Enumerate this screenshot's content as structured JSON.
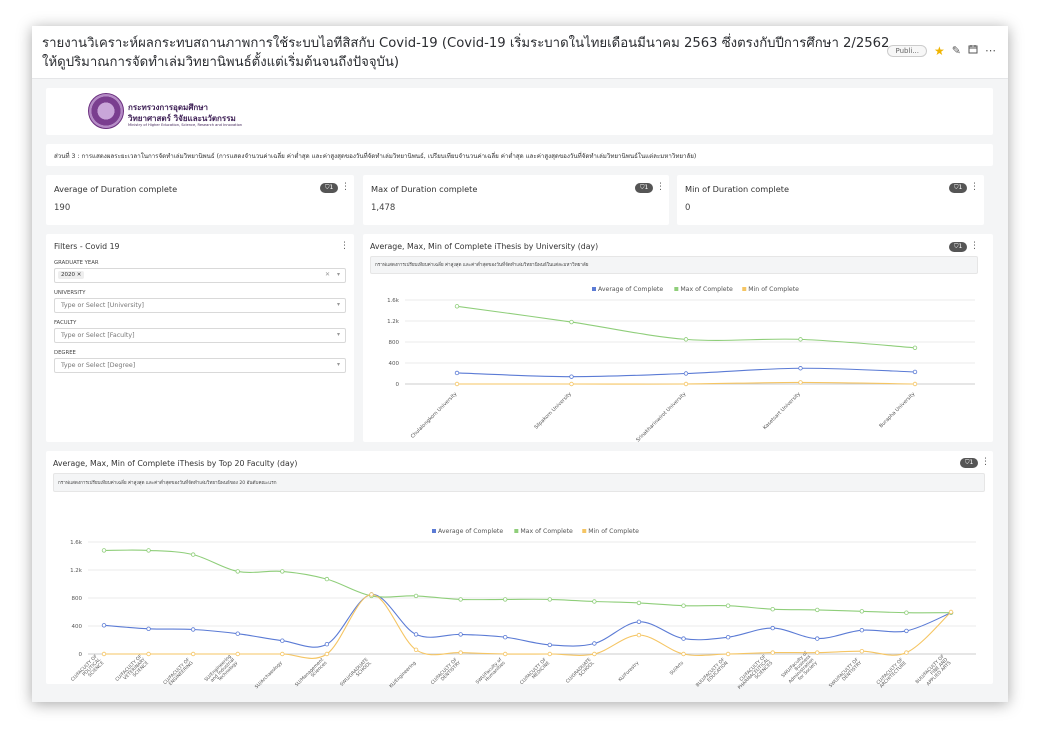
{
  "header": {
    "title": "รายงานวิเคราะห์ผลกระทบสถานภาพการใช้ระบบไอทีสิสกับ Covid-19 (Covid-19 เริ่มระบาดในไทยเดือนมีนาคม 2563 ซึ่งตรงกับปีการศึกษา 2/2562 ให้ดูปริมาณการจัดทำเล่มวิทยานิพนธ์ตั้งแต่เริ่มต้นจนถึงปัจจุบัน)",
    "status_label": "Publi...",
    "icons": [
      "star-icon",
      "edit-icon",
      "calendar-icon",
      "more-icon"
    ],
    "star_color": "#f0b400"
  },
  "logo": {
    "line1": "กระทรวงการอุดมศึกษา",
    "line2": "วิทยาศาสตร์ วิจัยและนวัตกรรม",
    "line3": "Ministry of Higher Education, Science, Research and Innovation"
  },
  "section_text": "ส่วนที่ 3 : การแสดงผลระยะเวลาในการจัดทำเล่มวิทยานิพนธ์ (การแสดงจำนวนค่าเฉลี่ย ค่าต่ำสุด และค่าสูงสุดของวันที่จัดทำเล่มวิทยานิพนธ์, เปรียบเทียบจำนวนค่าเฉลี่ย ค่าต่ำสุด และค่าสูงสุดของวันที่จัดทำเล่มวิทยานิพนธ์ในแต่ละมหาวิทยาลัย)",
  "filter_badge": "1",
  "kpis": [
    {
      "label": "Average of Duration complete",
      "value": "190"
    },
    {
      "label": "Max of Duration complete",
      "value": "1,478"
    },
    {
      "label": "Min of Duration complete",
      "value": "0"
    }
  ],
  "filters": {
    "title": "Filters - Covid 19",
    "fields": [
      {
        "label": "GRADUATE YEAR",
        "selected": "2020"
      },
      {
        "label": "UNIVERSITY",
        "placeholder": "Type or Select [University]"
      },
      {
        "label": "FACULTY",
        "placeholder": "Type or Select [Faculty]"
      },
      {
        "label": "DEGREE",
        "placeholder": "Type or Select [Degree]"
      }
    ]
  },
  "colors": {
    "average": "#5b7bd5",
    "max": "#8fce7a",
    "min": "#f5c563"
  },
  "chart_data": [
    {
      "type": "line",
      "title": "Average, Max, Min of Complete iThesis by University (day)",
      "description": "กราฟแสดงการเปรียบเทียบค่าเฉลี่ย ค่าสูงสุด และค่าต่ำสุดของวันที่จัดทำเล่มวิทยานิพนธ์ในแต่ละมหาวิทยาลัย",
      "categories": [
        "Chulalongkorn University",
        "Silpakorn University",
        "Srinakharinwirot University",
        "Kasetsart University",
        "Burapha University"
      ],
      "series": [
        {
          "name": "Average of Complete",
          "values": [
            210,
            140,
            200,
            300,
            230
          ]
        },
        {
          "name": "Max of Complete",
          "values": [
            1480,
            1180,
            850,
            850,
            690
          ]
        },
        {
          "name": "Min of Complete",
          "values": [
            0,
            0,
            0,
            30,
            0
          ]
        }
      ],
      "yticks": [
        "0",
        "400",
        "800",
        "1.2k",
        "1.6k"
      ],
      "ylim": [
        0,
        1600
      ],
      "legend": "top"
    },
    {
      "type": "line",
      "title": "Average, Max, Min of Complete iThesis by Top 20 Faculty (day)",
      "description": "กราฟแสดงการเปรียบเทียบค่าเฉลี่ย ค่าสูงสุด และค่าต่ำสุดของวันที่จัดทำเล่มวิทยานิพนธ์ของ 20 อันดับคณะแรก",
      "categories": [
        "CU/FACULTY OF POLITICAL SCIENCE",
        "CU/FACULTY OF VETERINARY SCIENCE",
        "CU/FACULTY OF ENGINEERING",
        "SU/Engineering and Industrial Technology",
        "SU/Archaeology",
        "SU/Management Sciences",
        "SWU/GRADUATE SCHOOL",
        "KU/Engineering",
        "CU/FACULTY OF DENTISTRY",
        "SWU/Faculty of Humanities",
        "CU/FACULTY OF MEDICINE",
        "CU/GRADUATE SCHOOL",
        "KU/Forestry",
        "SU/Arts",
        "BUU/FACULTY OF EDUCATION",
        "CU/FACULTY OF PHARMACEUTICAL SCIENCES",
        "SWU/Faculty of Business Administration for Society",
        "SWU/FACULTY OF DENTISTRY",
        "CU/FACULTY OF ARCHITECTURE",
        "BUU/FACULTY OF FINE AND APPLIED ARTS"
      ],
      "series": [
        {
          "name": "Average of Complete",
          "values": [
            410,
            360,
            350,
            290,
            190,
            140,
            850,
            280,
            280,
            240,
            130,
            150,
            460,
            220,
            240,
            370,
            220,
            340,
            330,
            590
          ]
        },
        {
          "name": "Max of Complete",
          "values": [
            1480,
            1480,
            1420,
            1180,
            1180,
            1070,
            830,
            830,
            780,
            780,
            780,
            750,
            730,
            690,
            690,
            640,
            630,
            610,
            590,
            590
          ]
        },
        {
          "name": "Min of Complete",
          "values": [
            0,
            0,
            0,
            0,
            0,
            0,
            850,
            60,
            20,
            0,
            0,
            0,
            270,
            0,
            0,
            20,
            20,
            40,
            20,
            600
          ]
        }
      ],
      "yticks": [
        "0",
        "400",
        "800",
        "1.2k",
        "1.6k"
      ],
      "ylim": [
        0,
        1600
      ],
      "legend": "top"
    }
  ]
}
